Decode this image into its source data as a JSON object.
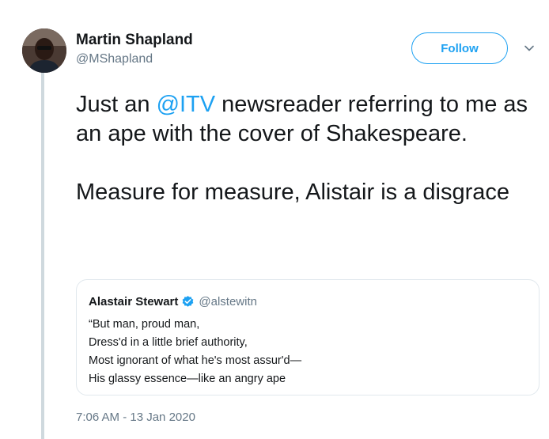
{
  "author": {
    "name": "Martin Shapland",
    "handle": "@MShapland"
  },
  "follow_button": {
    "label": "Follow"
  },
  "menu": {
    "icon": "chevron-down-icon"
  },
  "tweet": {
    "paragraph1": {
      "prefix": "Just an ",
      "mention": "@ITV",
      "suffix": " newsreader referring to me as an ape with the cover of Shakespeare."
    },
    "paragraph2": "Measure for measure, Alistair is a disgrace"
  },
  "quoted_tweet": {
    "name": "Alastair Stewart",
    "verified": true,
    "handle": "@alstewitn",
    "lines": [
      "“But man, proud man,",
      "Dress'd in a little brief authority,",
      "Most ignorant of what he's most assur'd—",
      "His glassy essence—like an angry ape"
    ]
  },
  "timestamp": "7:06 AM - 13 Jan 2020",
  "colors": {
    "accent": "#1da1f2",
    "text": "#14171a",
    "secondary_text": "#657786",
    "border": "#e1e8ed"
  }
}
